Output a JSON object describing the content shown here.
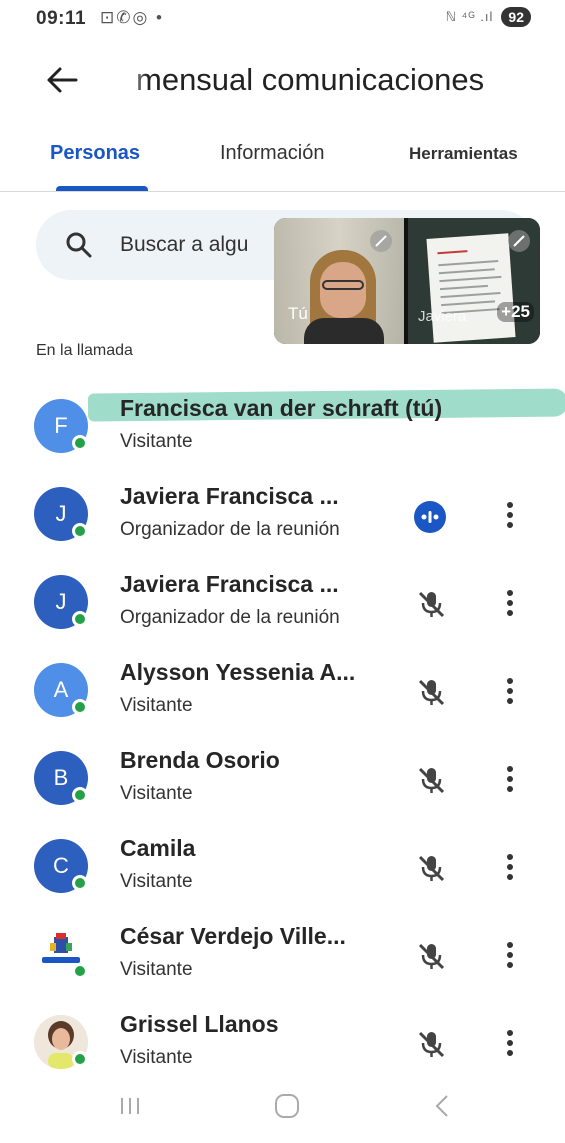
{
  "status_bar": {
    "time": "09:11",
    "left_icons": "⊡✆◎ •",
    "signal": "ℕ ⁴ᴳ .ıl",
    "battery": "92"
  },
  "header": {
    "title": "mensual comunicaciones"
  },
  "tabs": [
    {
      "label": "Personas",
      "active": true
    },
    {
      "label": "Información",
      "active": false
    },
    {
      "label": "Herramientas",
      "active": false
    }
  ],
  "search": {
    "placeholder": "Buscar a algu"
  },
  "video": {
    "self_label": "Tú",
    "other_label": "Javiera",
    "more_count": "+25"
  },
  "section_label": "En la llamada",
  "participants": [
    {
      "initial": "F",
      "name": "Francisca van der schraft (tú)",
      "role": "Visitante",
      "avatar_style": "light",
      "mic": "none"
    },
    {
      "initial": "J",
      "name": "Javiera Francisca ...",
      "role": "Organizador de la reunión",
      "avatar_style": "dark",
      "mic": "speaking"
    },
    {
      "initial": "J",
      "name": "Javiera Francisca ...",
      "role": "Organizador de la reunión",
      "avatar_style": "dark",
      "mic": "muted"
    },
    {
      "initial": "A",
      "name": "Alysson Yessenia A...",
      "role": "Visitante",
      "avatar_style": "light",
      "mic": "muted"
    },
    {
      "initial": "B",
      "name": "Brenda Osorio",
      "role": "Visitante",
      "avatar_style": "dark",
      "mic": "muted"
    },
    {
      "initial": "C",
      "name": "Camila",
      "role": "Visitante",
      "avatar_style": "dark",
      "mic": "muted"
    },
    {
      "initial": "",
      "name": "César Verdejo Ville...",
      "role": "Visitante",
      "avatar_style": "logo",
      "mic": "muted"
    },
    {
      "initial": "",
      "name": "Grissel Llanos",
      "role": "Visitante",
      "avatar_style": "photo",
      "mic": "muted"
    }
  ],
  "colors": {
    "accent": "#1a56c4",
    "online": "#24a148",
    "highlight": "#7fd0b7",
    "avatar_light": "#4f8fe8",
    "avatar_dark": "#2d5fbe"
  }
}
